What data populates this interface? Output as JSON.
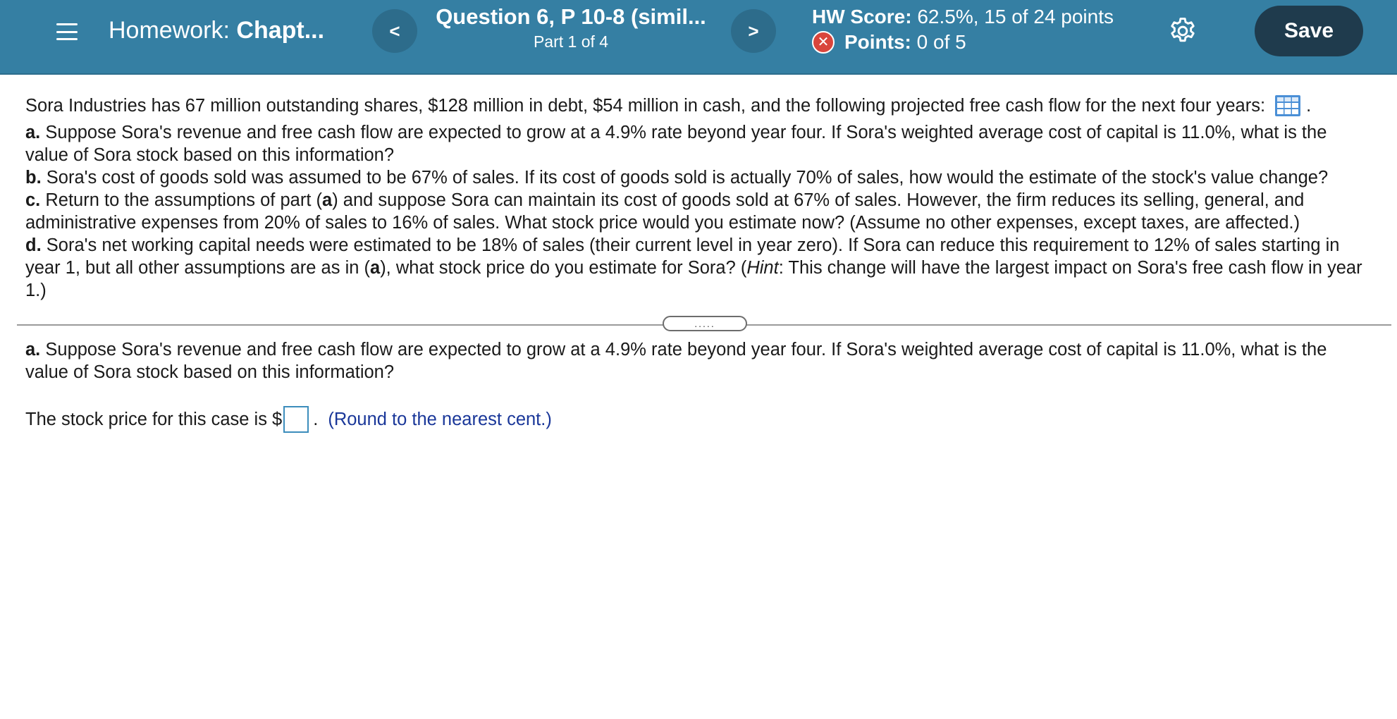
{
  "header": {
    "homework_prefix": "Homework:",
    "homework_name": "Chapt...",
    "prev_label": "<",
    "next_label": ">",
    "question_title": "Question 6, P 10-8 (simil...",
    "question_part": "Part 1 of 4",
    "hw_score_label": "HW Score:",
    "hw_score_value": "62.5%, 15 of 24 points",
    "points_label": "Points:",
    "points_value": "0 of 5",
    "save_label": "Save"
  },
  "question": {
    "intro": "Sora Industries has 67 million outstanding shares, $128 million in debt, $54 million in cash, and the following projected free cash flow for the next four years:",
    "intro_end": ".",
    "parts": [
      {
        "letter": "a.",
        "text": "Suppose Sora's revenue and free cash flow are expected to grow at a 4.9% rate beyond year four. If Sora's weighted average cost of capital is 11.0%, what is the value of Sora stock based on this information?"
      },
      {
        "letter": "b.",
        "text": "Sora's cost of goods sold was assumed to be 67% of sales. If its cost of goods sold is actually 70% of sales, how would the estimate of the stock's value change?"
      },
      {
        "letter": "c.",
        "text_1": "Return to the assumptions of part (",
        "ref": "a",
        "text_2": ") and suppose Sora can maintain its cost of goods sold at 67% of sales. However,  the firm reduces its selling, general, and administrative expenses from 20% of sales to 16% of sales. What stock price would you estimate now? (Assume no other expenses, except taxes, are affected.)"
      },
      {
        "letter": "d.",
        "text_1": "Sora's net working capital needs were estimated to be 18% of sales (their current level in year zero). If Sora can reduce this requirement to 12% of sales starting in year 1, but all other assumptions are as in (",
        "ref": "a",
        "text_2": "), what stock price do you estimate for Sora? (",
        "hint_word": "Hint",
        "text_3": ": This change will have the largest impact on Sora's free cash flow in year 1.)"
      }
    ]
  },
  "expander_label": ".....",
  "answer": {
    "letter": "a.",
    "question_text": "Suppose Sora's revenue and free cash flow are expected to grow at a 4.9% rate beyond year four. If Sora's weighted average cost of capital is 11.0%, what is the value of Sora stock based on this information?",
    "prompt": "The stock price for this case is $",
    "input_value": "",
    "after_input": ".",
    "hint": "(Round to the nearest cent.)"
  },
  "colors": {
    "header_bg": "#357fa3",
    "nav_button_bg": "#2d6c8b",
    "save_button_bg": "#1f3b4d",
    "error_red": "#d9453c",
    "hint_blue": "#1a3799",
    "input_border": "#3c8dbc"
  },
  "icons": {
    "menu": "hamburger-menu-icon",
    "settings": "gear-icon",
    "points_status": "x-circle-icon",
    "data_table": "table-grid-icon"
  }
}
